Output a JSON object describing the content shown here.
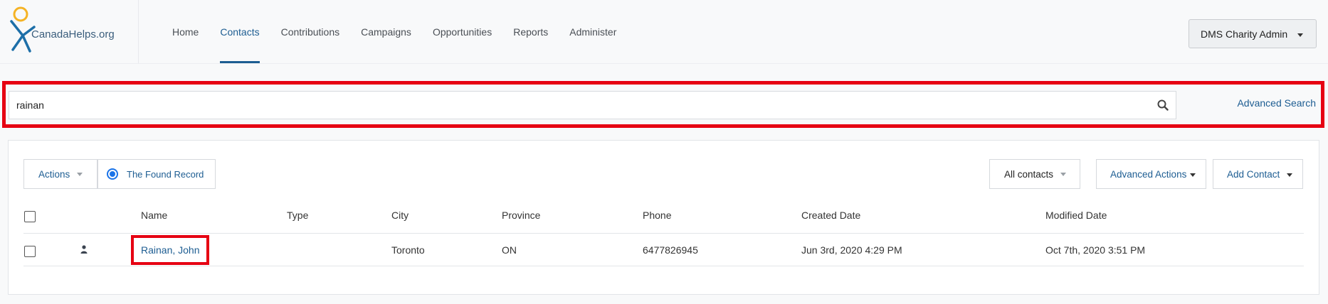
{
  "logo": {
    "text": "CanadaHelps.org"
  },
  "nav": {
    "items": [
      {
        "label": "Home",
        "active": false
      },
      {
        "label": "Contacts",
        "active": true
      },
      {
        "label": "Contributions",
        "active": false
      },
      {
        "label": "Campaigns",
        "active": false
      },
      {
        "label": "Opportunities",
        "active": false
      },
      {
        "label": "Reports",
        "active": false
      },
      {
        "label": "Administer",
        "active": false
      }
    ]
  },
  "user_menu": {
    "label": "DMS Charity Admin"
  },
  "search": {
    "value": "rainan",
    "advanced_label": "Advanced Search"
  },
  "toolbar": {
    "actions_label": "Actions",
    "found_record_label": "The Found Record",
    "filter_label": "All contacts",
    "advanced_actions_label": "Advanced Actions",
    "add_contact_label": "Add Contact"
  },
  "table": {
    "headers": [
      "Name",
      "Type",
      "City",
      "Province",
      "Phone",
      "Created Date",
      "Modified Date"
    ],
    "rows": [
      {
        "name": "Rainan, John",
        "type": "",
        "city": "Toronto",
        "province": "ON",
        "phone": "6477826945",
        "created": "Jun 3rd, 2020 4:29 PM",
        "modified": "Oct 7th, 2020 3:51 PM"
      }
    ]
  },
  "colors": {
    "accent": "#1d5d92",
    "highlight": "#e60012"
  }
}
